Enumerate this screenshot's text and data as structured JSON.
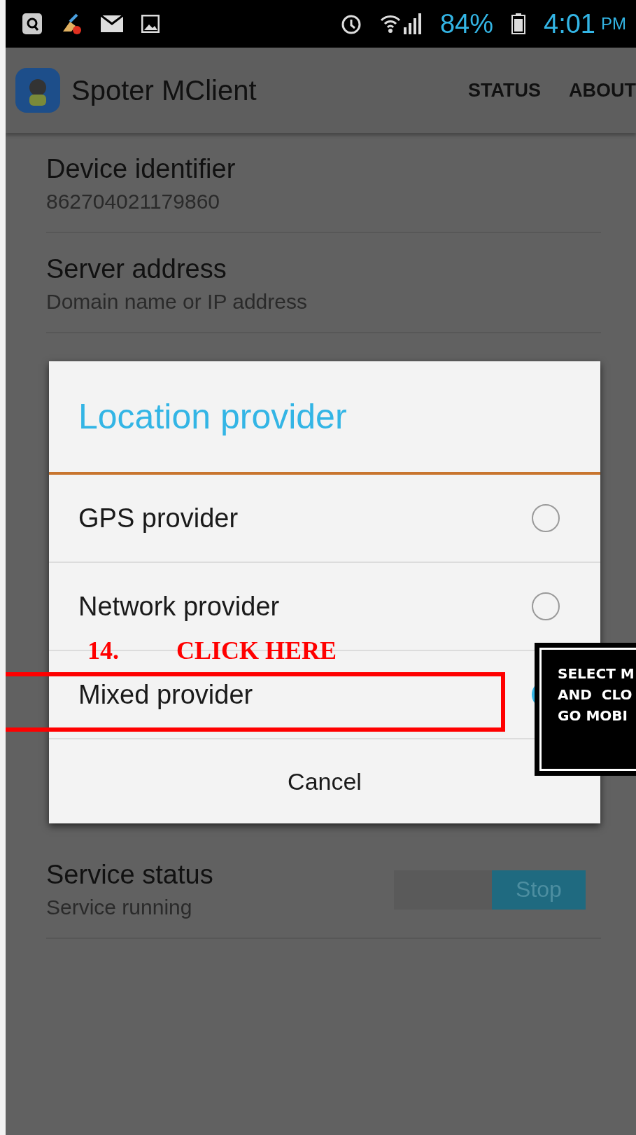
{
  "status_bar": {
    "battery": "84%",
    "time": "4:01",
    "meridiem": "PM"
  },
  "app_bar": {
    "title": "Spoter MClient",
    "actions": [
      "STATUS",
      "ABOUT"
    ]
  },
  "settings": [
    {
      "title": "Device identifier",
      "summary": "862704021179860"
    },
    {
      "title": "Server address",
      "summary": "Domain name or IP address"
    }
  ],
  "service": {
    "title": "Service status",
    "summary": "Service running",
    "button": "Stop"
  },
  "dialog": {
    "title": "Location provider",
    "options": [
      {
        "label": "GPS provider",
        "selected": false
      },
      {
        "label": "Network provider",
        "selected": false
      },
      {
        "label": "Mixed provider",
        "selected": true
      }
    ],
    "cancel": "Cancel"
  },
  "annotation": {
    "step": "14.",
    "instruction": "CLICK HERE",
    "callout_lines": [
      "SELECT M",
      "AND  CLO",
      "GO MOBI"
    ]
  }
}
